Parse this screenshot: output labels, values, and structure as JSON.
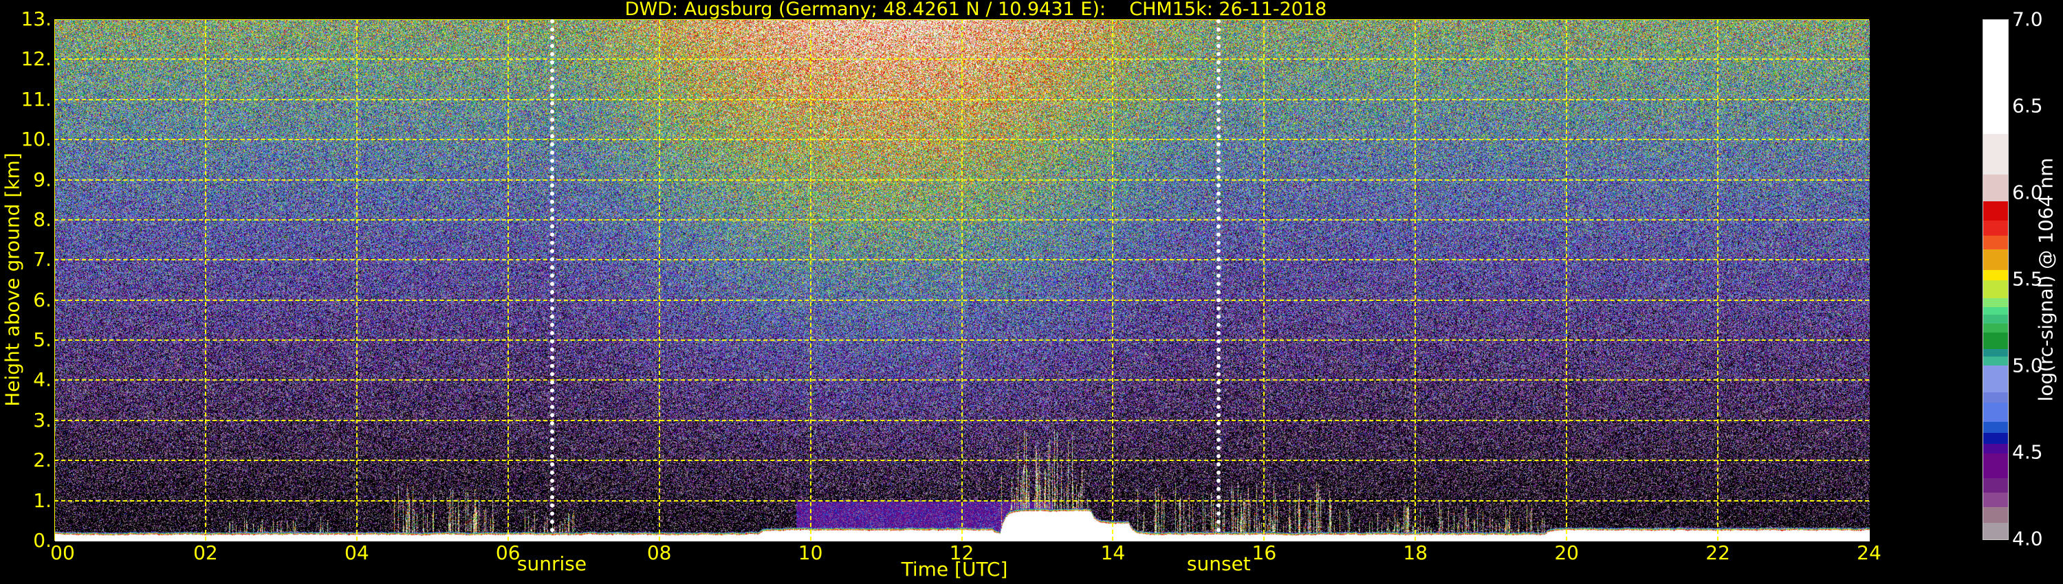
{
  "chart_data": {
    "type": "heatmap",
    "title": "DWD: Augsburg (Germany; 48.4261 N / 10.9431 E):    CHM15k: 26-11-2018",
    "xlabel": "Time [UTC]",
    "ylabel": "Height above ground [km]",
    "xlim": [
      0,
      24
    ],
    "ylim": [
      0,
      13
    ],
    "x_ticks": [
      "00",
      "02",
      "04",
      "06",
      "08",
      "10",
      "12",
      "14",
      "16",
      "18",
      "20",
      "22",
      "24"
    ],
    "x_tick_values": [
      0,
      2,
      4,
      6,
      8,
      10,
      12,
      14,
      16,
      18,
      20,
      22,
      24
    ],
    "y_ticks": [
      "0.",
      "1.",
      "2.",
      "3.",
      "4.",
      "5.",
      "6.",
      "7.",
      "8.",
      "9.",
      "10.",
      "11.",
      "12.",
      "13."
    ],
    "y_tick_values": [
      0,
      1,
      2,
      3,
      4,
      5,
      6,
      7,
      8,
      9,
      10,
      11,
      12,
      13
    ],
    "grid": true,
    "grid_color": "#ffff00",
    "sun_events": [
      {
        "label": "sunrise",
        "time": 6.58
      },
      {
        "label": "sunset",
        "time": 15.4
      }
    ],
    "colorbar": {
      "label": "log(rc-signal) @ 1064 nm",
      "range": [
        4.0,
        7.0
      ],
      "ticks": [
        "4.0",
        "4.5",
        "5.0",
        "5.5",
        "6.0",
        "6.5",
        "7.0"
      ],
      "tick_values": [
        4.0,
        4.5,
        5.0,
        5.5,
        6.0,
        6.5,
        7.0
      ],
      "bounds": [
        4.0,
        4.097,
        4.189,
        4.273,
        4.354,
        4.498,
        4.554,
        4.618,
        4.68,
        4.79,
        4.852,
        5.004,
        5.056,
        5.103,
        5.197,
        5.249,
        5.298,
        5.345,
        5.395,
        5.496,
        5.556,
        5.678,
        5.755,
        5.845,
        5.953,
        6.109,
        6.343,
        7.0
      ],
      "colors": [
        "#a89ca4",
        "#9c7a8c",
        "#8c4890",
        "#722484",
        "#6a0888",
        "#4c0898",
        "#0c18a8",
        "#2058cc",
        "#5a7ce8",
        "#6c80dc",
        "#8898e8",
        "#3cb894",
        "#20908a",
        "#1a9632",
        "#36b452",
        "#3cc07a",
        "#4edc88",
        "#86e870",
        "#c2e63a",
        "#ffe600",
        "#e8a412",
        "#f05a22",
        "#e8261e",
        "#d80808",
        "#e3c8c8",
        "#efe8e6",
        "#ffffff"
      ]
    },
    "features": [
      {
        "kind": "surface layer",
        "t0": 0,
        "t1": 24,
        "top_km": 0.2
      },
      {
        "kind": "aerosol spikes",
        "t0": 2.2,
        "t1": 3.2,
        "top_km": 0.6
      },
      {
        "kind": "low cloud",
        "t0": 3.4,
        "t1": 3.65,
        "top_km": 0.65
      },
      {
        "kind": "low cloud",
        "t0": 4.45,
        "t1": 5.55,
        "top_km": 1.5
      },
      {
        "kind": "low cloud",
        "t0": 5.5,
        "t1": 5.85,
        "top_km": 1.55
      },
      {
        "kind": "aerosol",
        "t0": 6.2,
        "t1": 6.9,
        "top_km": 0.85
      },
      {
        "kind": "mixing layer",
        "t0": 9.3,
        "t1": 12.4,
        "top_km": 0.35
      },
      {
        "kind": "elevated aerosol layer",
        "t0": 9.8,
        "t1": 13.2,
        "top_km": 1.0
      },
      {
        "kind": "convective cloud",
        "t0": 12.5,
        "t1": 13.7,
        "top_km": 2.8
      },
      {
        "kind": "aerosol spikes",
        "t0": 14.3,
        "t1": 17.0,
        "top_km": 1.5
      },
      {
        "kind": "aerosol spikes",
        "t0": 17.0,
        "t1": 19.7,
        "top_km": 1.0
      },
      {
        "kind": "residual layer",
        "t0": 19.7,
        "t1": 24,
        "top_km": 0.35
      }
    ]
  }
}
